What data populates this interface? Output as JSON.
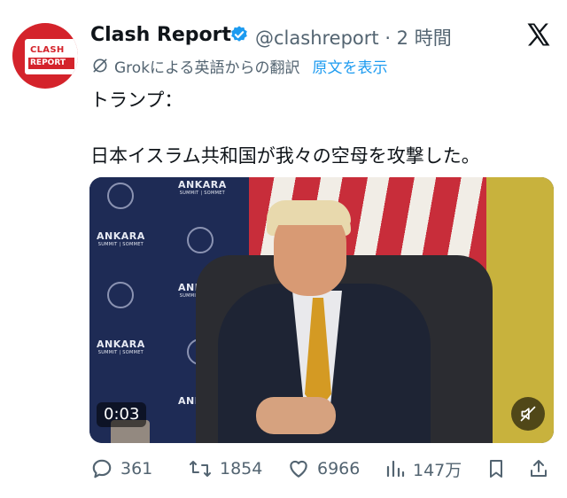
{
  "account": {
    "display_name": "Clash Report",
    "handle": "@clashreport",
    "time_ago": "2 時間",
    "verified": true,
    "avatar_text_top": "CLASH",
    "avatar_text_bottom": "REPORT",
    "avatar_color": "#d4232b"
  },
  "translation": {
    "note": "Grokによる英語からの翻訳",
    "show_original": "原文を表示"
  },
  "tweet": {
    "line1": "トランプ：",
    "line2": "日本イスラム共和国が我々の空母を攻撃した。"
  },
  "video": {
    "timestamp": "0:03",
    "backdrop_text": "ANKARA",
    "backdrop_subtext": "SUMMIT | SOMMET",
    "muted": true
  },
  "actions": {
    "replies": "361",
    "reposts": "1854",
    "likes": "6966",
    "views": "147万"
  },
  "icons": {
    "verified": "verified-badge-icon",
    "platform": "x-logo-icon",
    "translate": "grok-translate-icon",
    "reply": "reply-icon",
    "repost": "repost-icon",
    "like": "heart-icon",
    "views": "views-bar-icon",
    "bookmark": "bookmark-icon",
    "share": "share-icon",
    "mute": "muted-speaker-icon"
  },
  "colors": {
    "link": "#1d9bf0",
    "secondary_text": "#536471",
    "primary_text": "#0f1419"
  }
}
